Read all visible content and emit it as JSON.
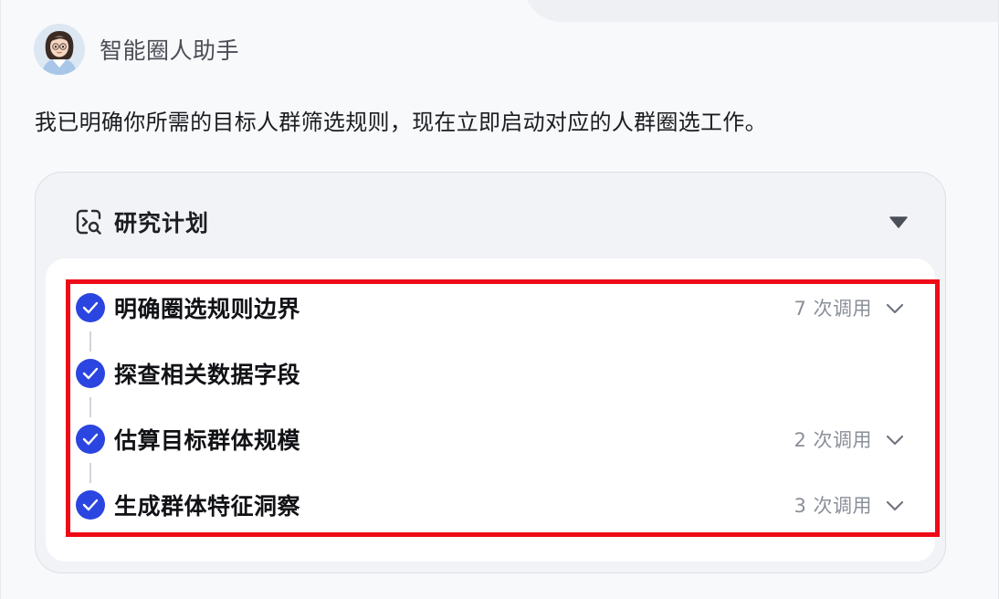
{
  "assistant": {
    "name": "智能圈人助手"
  },
  "message": {
    "text": "我已明确你所需的目标人群筛选规则，现在立即启动对应的人群圈选工作。"
  },
  "plan": {
    "title": "研究计划",
    "icon": "search-plan-icon",
    "toggle_icon": "caret-down-icon",
    "steps": [
      {
        "label": "明确圈选规则边界",
        "calls": "7 次调用",
        "status": "completed",
        "expandable": true
      },
      {
        "label": "探查相关数据字段",
        "calls": "",
        "status": "completed",
        "expandable": false
      },
      {
        "label": "估算目标群体规模",
        "calls": "2 次调用",
        "status": "completed",
        "expandable": true
      },
      {
        "label": "生成群体特征洞察",
        "calls": "3 次调用",
        "status": "completed",
        "expandable": true
      }
    ]
  },
  "colors": {
    "check_blue": "#2b45e0",
    "highlight_red": "#ee0a16",
    "muted_text": "#8a8f99"
  }
}
